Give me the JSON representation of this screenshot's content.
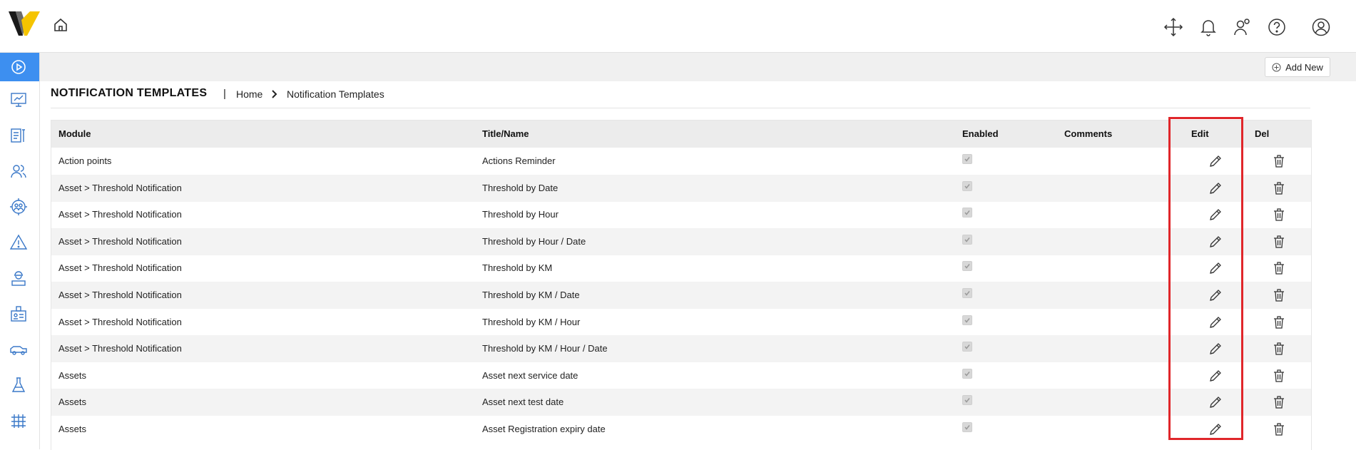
{
  "header": {
    "icons": [
      "logo-icon",
      "home-icon",
      "fullscreen-icon",
      "bell-icon",
      "user-settings-icon",
      "help-icon",
      "profile-icon"
    ]
  },
  "sidebar": {
    "icons": [
      "play-icon",
      "dashboard-icon",
      "document-tools-icon",
      "users-icon",
      "group-target-icon",
      "warning-icon",
      "worker-icon",
      "id-card-icon",
      "vehicle-icon",
      "lab-flask-icon",
      "structure-icon"
    ],
    "active_color": "#3d8ff0"
  },
  "toolbar": {
    "add_new_label": "Add New"
  },
  "page": {
    "title": "NOTIFICATION TEMPLATES",
    "breadcrumb_sep": "|",
    "breadcrumb_home": "Home",
    "breadcrumb_current": "Notification Templates"
  },
  "table": {
    "headers": {
      "module": "Module",
      "title": "Title/Name",
      "enabled": "Enabled",
      "comments": "Comments",
      "edit": "Edit",
      "del": "Del"
    },
    "rows": [
      {
        "module": "Action points",
        "title": "Actions Reminder",
        "enabled": true,
        "comments": ""
      },
      {
        "module": "Asset > Threshold Notification",
        "title": "Threshold by Date",
        "enabled": true,
        "comments": ""
      },
      {
        "module": "Asset > Threshold Notification",
        "title": "Threshold by Hour",
        "enabled": true,
        "comments": ""
      },
      {
        "module": "Asset > Threshold Notification",
        "title": "Threshold by Hour / Date",
        "enabled": true,
        "comments": ""
      },
      {
        "module": "Asset > Threshold Notification",
        "title": "Threshold by KM",
        "enabled": true,
        "comments": ""
      },
      {
        "module": "Asset > Threshold Notification",
        "title": "Threshold by KM / Date",
        "enabled": true,
        "comments": ""
      },
      {
        "module": "Asset > Threshold Notification",
        "title": "Threshold by KM / Hour",
        "enabled": true,
        "comments": ""
      },
      {
        "module": "Asset > Threshold Notification",
        "title": "Threshold by KM / Hour / Date",
        "enabled": true,
        "comments": ""
      },
      {
        "module": "Assets",
        "title": "Asset next service date",
        "enabled": true,
        "comments": ""
      },
      {
        "module": "Assets",
        "title": "Asset next test date",
        "enabled": true,
        "comments": ""
      },
      {
        "module": "Assets",
        "title": "Asset Registration expiry date",
        "enabled": true,
        "comments": ""
      }
    ]
  },
  "colors": {
    "highlight": "#e0262a",
    "header_bg": "#ececec",
    "alt_row": "#f3f3f3"
  }
}
